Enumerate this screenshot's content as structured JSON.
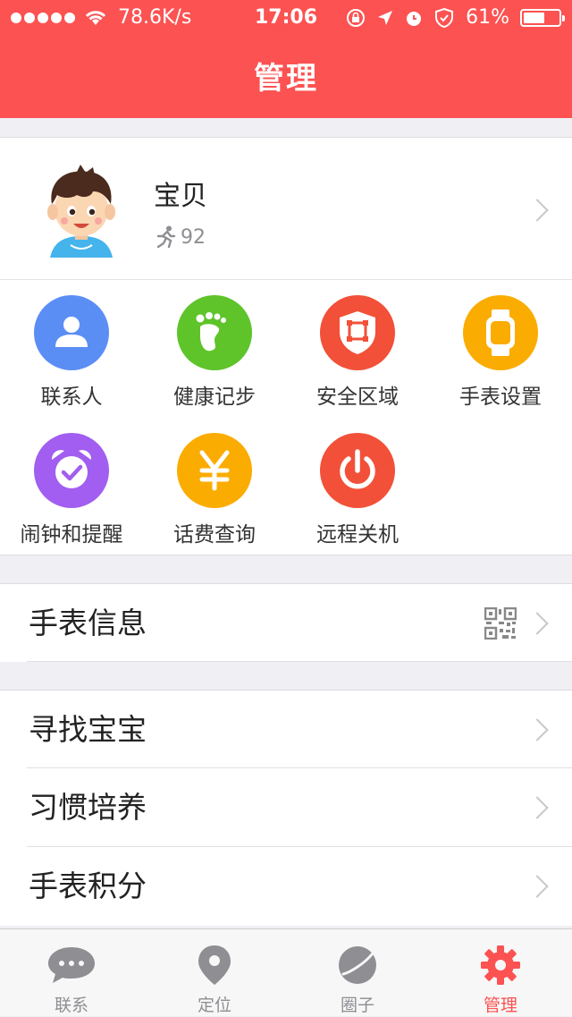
{
  "status_bar": {
    "network_speed": "78.6K/s",
    "time": "17:06",
    "battery_percent": "61%",
    "battery_level": 0.61
  },
  "header": {
    "title": "管理"
  },
  "profile": {
    "name": "宝贝",
    "steps": "92"
  },
  "grid": {
    "items": [
      {
        "label": "联系人",
        "icon": "contacts-icon",
        "color": "#5b8ef5"
      },
      {
        "label": "健康记步",
        "icon": "footprint-icon",
        "color": "#5ec42a"
      },
      {
        "label": "安全区域",
        "icon": "safe-zone-icon",
        "color": "#f25038"
      },
      {
        "label": "手表设置",
        "icon": "watch-icon",
        "color": "#fbac00"
      },
      {
        "label": "闹钟和提醒",
        "icon": "alarm-icon",
        "color": "#a15ef0"
      },
      {
        "label": "话费查询",
        "icon": "yuan-icon",
        "color": "#fbac00"
      },
      {
        "label": "远程关机",
        "icon": "power-icon",
        "color": "#f25038"
      }
    ]
  },
  "menu": {
    "watch_info": "手表信息",
    "find_baby": "寻找宝宝",
    "habit": "习惯培养",
    "points": "手表积分"
  },
  "tabs": [
    {
      "label": "联系",
      "icon": "chat-bubble-icon",
      "active": false
    },
    {
      "label": "定位",
      "icon": "location-pin-icon",
      "active": false
    },
    {
      "label": "圈子",
      "icon": "planet-icon",
      "active": false
    },
    {
      "label": "管理",
      "icon": "gear-icon",
      "active": true
    }
  ],
  "colors": {
    "accent": "#fc5252",
    "inactive": "#8e8e93"
  }
}
